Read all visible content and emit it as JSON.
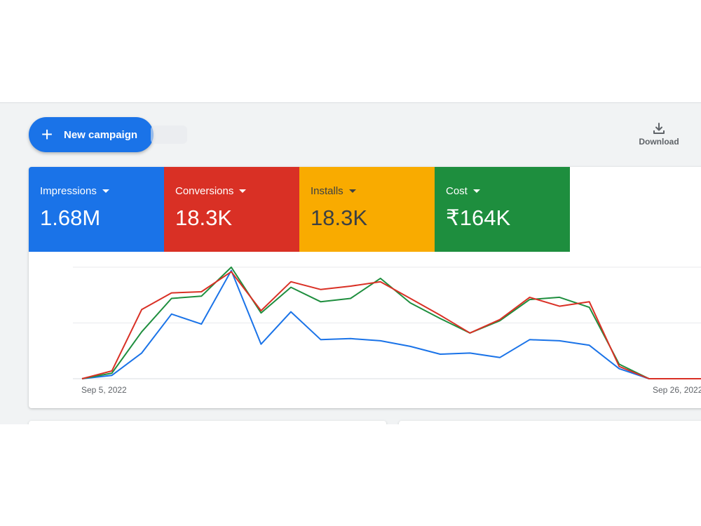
{
  "toolbar": {
    "new_campaign_label": "New campaign",
    "download_label": "Download"
  },
  "metrics": [
    {
      "label": "Impressions",
      "value": "1.68M",
      "color": "#1a73e8"
    },
    {
      "label": "Conversions",
      "value": "18.3K",
      "color": "#d93025"
    },
    {
      "label": "Installs",
      "value": "18.3K",
      "color": "#f9ab00"
    },
    {
      "label": "Cost",
      "value": "₹164K",
      "color": "#1e8e3e"
    }
  ],
  "chart_data": {
    "type": "line",
    "x_start_label": "Sep 5, 2022",
    "x_end_label": "Sep 26, 2022",
    "x": [
      "Sep 5, 2022",
      "Sep 6, 2022",
      "Sep 7, 2022",
      "Sep 8, 2022",
      "Sep 9, 2022",
      "Sep 10, 2022",
      "Sep 11, 2022",
      "Sep 12, 2022",
      "Sep 13, 2022",
      "Sep 14, 2022",
      "Sep 15, 2022",
      "Sep 16, 2022",
      "Sep 17, 2022",
      "Sep 18, 2022",
      "Sep 19, 2022",
      "Sep 20, 2022",
      "Sep 21, 2022",
      "Sep 22, 2022",
      "Sep 23, 2022",
      "Sep 24, 2022",
      "Sep 25, 2022",
      "Sep 26, 2022"
    ],
    "ylim": [
      0,
      100
    ],
    "grid": true,
    "series": [
      {
        "metric": "Impressions",
        "color": "#1a73e8",
        "values": [
          0,
          3,
          23,
          58,
          49,
          97,
          31,
          60,
          35,
          36,
          34,
          29,
          22,
          23,
          19,
          35,
          34,
          30,
          9,
          0,
          0,
          0
        ]
      },
      {
        "metric": "Installs",
        "color": "#1e8e3e",
        "values": [
          0,
          5,
          42,
          72,
          74,
          100,
          59,
          82,
          69,
          72,
          90,
          68,
          54,
          41,
          52,
          71,
          73,
          64,
          13,
          0,
          0,
          0
        ]
      },
      {
        "metric": "Conversions",
        "color": "#d93025",
        "values": [
          0,
          7,
          62,
          77,
          78,
          96,
          61,
          87,
          80,
          83,
          87,
          72,
          57,
          41,
          53,
          73,
          65,
          69,
          11,
          0,
          0,
          0
        ]
      }
    ]
  }
}
